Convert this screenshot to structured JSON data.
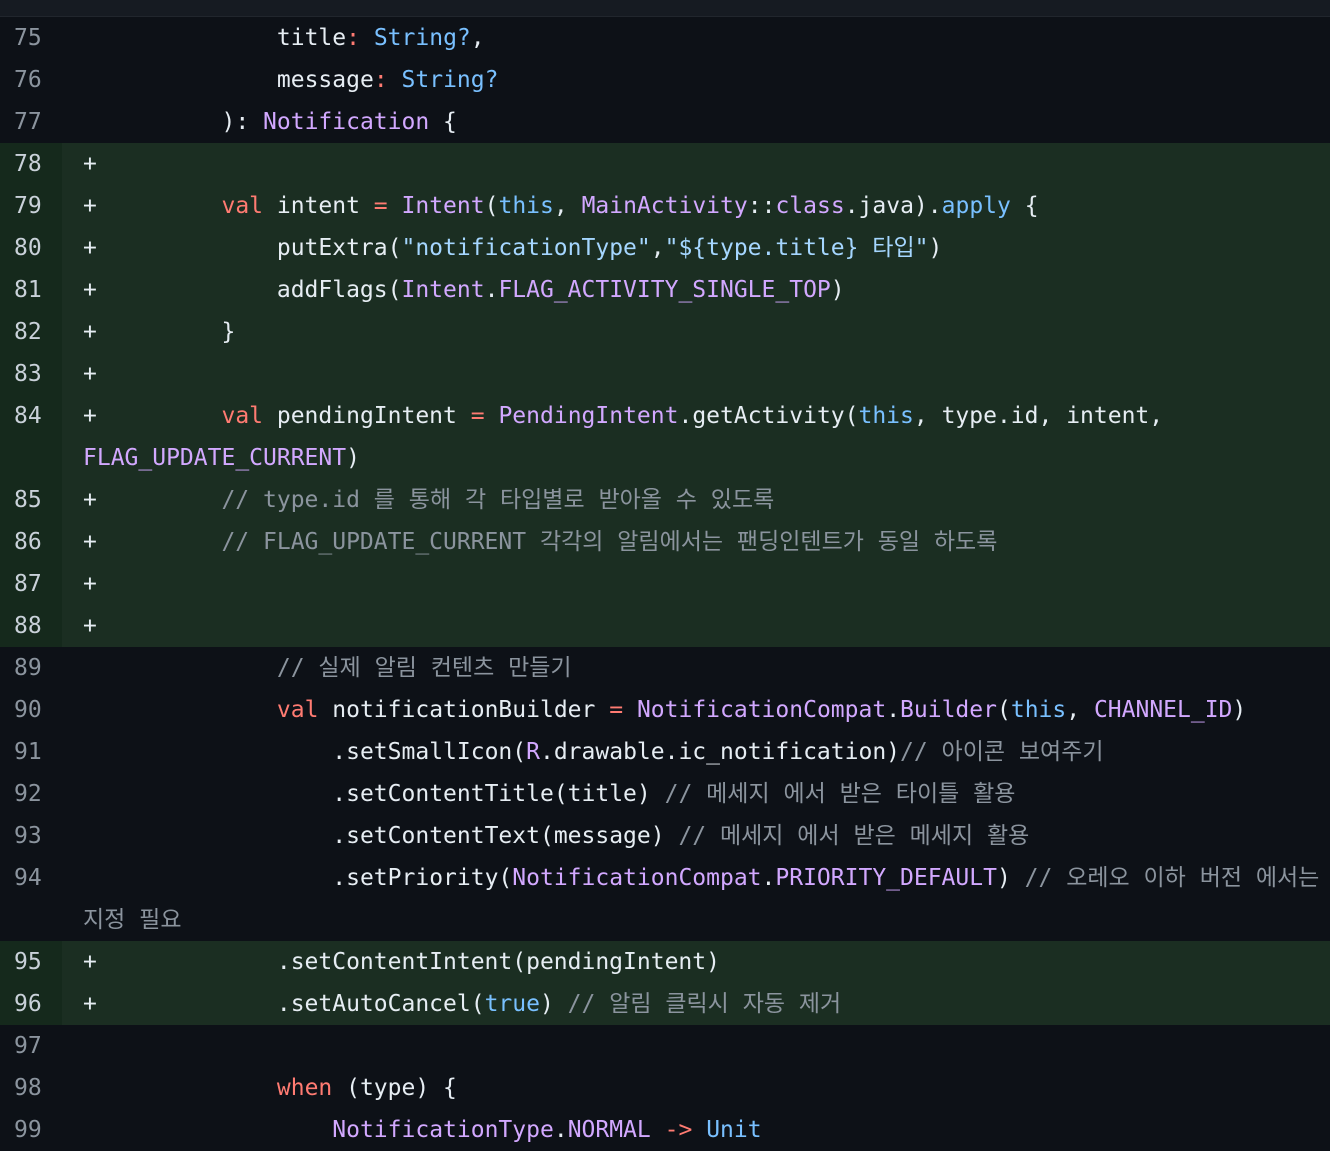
{
  "diff": {
    "lines": [
      {
        "n": "75",
        "add": false,
        "tokens": [
          [
            "pl",
            "            title"
          ],
          [
            "kw",
            ":"
          ],
          [
            "pl",
            " "
          ],
          [
            "bl",
            "String?"
          ],
          [
            "pl",
            ","
          ]
        ]
      },
      {
        "n": "76",
        "add": false,
        "tokens": [
          [
            "pl",
            "            message"
          ],
          [
            "kw",
            ":"
          ],
          [
            "pl",
            " "
          ],
          [
            "bl",
            "String?"
          ]
        ]
      },
      {
        "n": "77",
        "add": false,
        "tokens": [
          [
            "pl",
            "        ): "
          ],
          [
            "ty",
            "Notification"
          ],
          [
            "pl",
            " {"
          ]
        ]
      },
      {
        "n": "78",
        "add": true,
        "tokens": []
      },
      {
        "n": "79",
        "add": true,
        "tokens": [
          [
            "pl",
            "        "
          ],
          [
            "kw",
            "val"
          ],
          [
            "pl",
            " intent "
          ],
          [
            "kw",
            "="
          ],
          [
            "pl",
            " "
          ],
          [
            "ty",
            "Intent"
          ],
          [
            "pl",
            "("
          ],
          [
            "bl",
            "this"
          ],
          [
            "pl",
            ", "
          ],
          [
            "ty",
            "MainActivity"
          ],
          [
            "pl",
            "::"
          ],
          [
            "ty",
            "class"
          ],
          [
            "pl",
            ".java)."
          ],
          [
            "bl",
            "apply"
          ],
          [
            "pl",
            " {"
          ]
        ]
      },
      {
        "n": "80",
        "add": true,
        "tokens": [
          [
            "pl",
            "            putExtra("
          ],
          [
            "st",
            "\"notificationType\""
          ],
          [
            "pl",
            ","
          ],
          [
            "st",
            "\"${type.title} 타입\""
          ],
          [
            "pl",
            ")"
          ]
        ]
      },
      {
        "n": "81",
        "add": true,
        "tokens": [
          [
            "pl",
            "            addFlags("
          ],
          [
            "ty",
            "Intent"
          ],
          [
            "pl",
            "."
          ],
          [
            "ty",
            "FLAG_ACTIVITY_SINGLE_TOP"
          ],
          [
            "pl",
            ")"
          ]
        ]
      },
      {
        "n": "82",
        "add": true,
        "tokens": [
          [
            "pl",
            "        }"
          ]
        ]
      },
      {
        "n": "83",
        "add": true,
        "tokens": []
      },
      {
        "n": "84",
        "add": true,
        "tokens": [
          [
            "pl",
            "        "
          ],
          [
            "kw",
            "val"
          ],
          [
            "pl",
            " pendingIntent "
          ],
          [
            "kw",
            "="
          ],
          [
            "pl",
            " "
          ],
          [
            "ty",
            "PendingIntent"
          ],
          [
            "pl",
            ".getActivity("
          ],
          [
            "bl",
            "this"
          ],
          [
            "pl",
            ", type.id, intent, "
          ],
          [
            "ty",
            "FLAG_UPDATE_CURRENT"
          ],
          [
            "pl",
            ")"
          ]
        ]
      },
      {
        "n": "85",
        "add": true,
        "tokens": [
          [
            "cm",
            "        // type.id 를 통해 각 타입별로 받아올 수 있도록"
          ]
        ]
      },
      {
        "n": "86",
        "add": true,
        "tokens": [
          [
            "cm",
            "        // FLAG_UPDATE_CURRENT 각각의 알림에서는 팬딩인텐트가 동일 하도록"
          ]
        ]
      },
      {
        "n": "87",
        "add": true,
        "tokens": []
      },
      {
        "n": "88",
        "add": true,
        "tokens": []
      },
      {
        "n": "89",
        "add": false,
        "tokens": [
          [
            "cm",
            "            // 실제 알림 컨텐츠 만들기"
          ]
        ]
      },
      {
        "n": "90",
        "add": false,
        "tokens": [
          [
            "pl",
            "            "
          ],
          [
            "kw",
            "val"
          ],
          [
            "pl",
            " notificationBuilder "
          ],
          [
            "kw",
            "="
          ],
          [
            "pl",
            " "
          ],
          [
            "ty",
            "NotificationCompat"
          ],
          [
            "pl",
            "."
          ],
          [
            "ty",
            "Builder"
          ],
          [
            "pl",
            "("
          ],
          [
            "bl",
            "this"
          ],
          [
            "pl",
            ", "
          ],
          [
            "ty",
            "CHANNEL_ID"
          ],
          [
            "pl",
            ")"
          ]
        ]
      },
      {
        "n": "91",
        "add": false,
        "tokens": [
          [
            "pl",
            "                .setSmallIcon("
          ],
          [
            "ty",
            "R"
          ],
          [
            "pl",
            ".drawable.ic_notification)"
          ],
          [
            "cm",
            "// 아이콘 보여주기"
          ]
        ]
      },
      {
        "n": "92",
        "add": false,
        "tokens": [
          [
            "pl",
            "                .setContentTitle(title) "
          ],
          [
            "cm",
            "// 메세지 에서 받은 타이틀 활용"
          ]
        ]
      },
      {
        "n": "93",
        "add": false,
        "tokens": [
          [
            "pl",
            "                .setContentText(message) "
          ],
          [
            "cm",
            "// 메세지 에서 받은 메세지 활용"
          ]
        ]
      },
      {
        "n": "94",
        "add": false,
        "tokens": [
          [
            "pl",
            "                .setPriority("
          ],
          [
            "ty",
            "NotificationCompat"
          ],
          [
            "pl",
            "."
          ],
          [
            "ty",
            "PRIORITY_DEFAULT"
          ],
          [
            "pl",
            ") "
          ],
          [
            "cm",
            "// 오레오 이하 버전 에서는 지정 필요"
          ]
        ]
      },
      {
        "n": "95",
        "add": true,
        "tokens": [
          [
            "pl",
            "            .setContentIntent(pendingIntent)"
          ]
        ]
      },
      {
        "n": "96",
        "add": true,
        "tokens": [
          [
            "pl",
            "            .setAutoCancel("
          ],
          [
            "bl",
            "true"
          ],
          [
            "pl",
            ") "
          ],
          [
            "cm",
            "// 알림 클릭시 자동 제거"
          ]
        ]
      },
      {
        "n": "97",
        "add": false,
        "tokens": []
      },
      {
        "n": "98",
        "add": false,
        "tokens": [
          [
            "pl",
            "            "
          ],
          [
            "kw",
            "when"
          ],
          [
            "pl",
            " (type) {"
          ]
        ]
      },
      {
        "n": "99",
        "add": false,
        "tokens": [
          [
            "pl",
            "                "
          ],
          [
            "ty",
            "NotificationType"
          ],
          [
            "pl",
            "."
          ],
          [
            "ty",
            "NORMAL"
          ],
          [
            "pl",
            " "
          ],
          [
            "kw",
            "->"
          ],
          [
            "pl",
            " "
          ],
          [
            "bl",
            "Unit"
          ]
        ]
      }
    ],
    "add_marker": "+"
  }
}
